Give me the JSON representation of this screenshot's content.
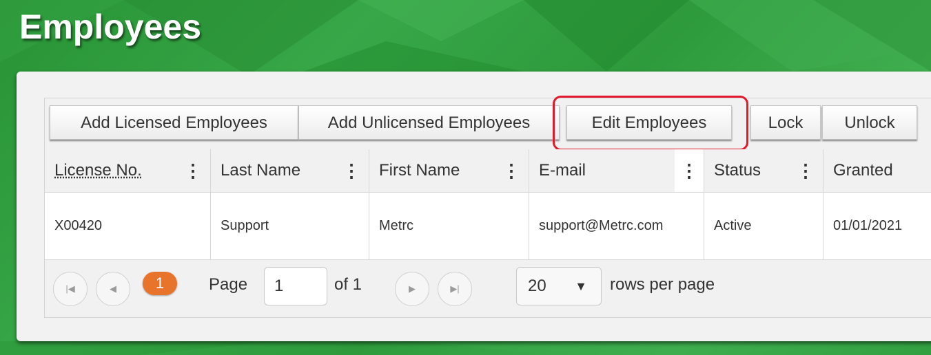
{
  "page": {
    "title": "Employees"
  },
  "toolbar": {
    "buttons": [
      {
        "label": "Add Licensed Employees"
      },
      {
        "label": "Add Unlicensed Employees"
      },
      {
        "label": "Edit Employees"
      },
      {
        "label": "Lock"
      },
      {
        "label": "Unlock"
      }
    ],
    "highlight_color": "#e2182c"
  },
  "table": {
    "columns": [
      {
        "label": "License No.",
        "menu_icon": "kebab-icon"
      },
      {
        "label": "Last Name",
        "menu_icon": "kebab-icon"
      },
      {
        "label": "First Name",
        "menu_icon": "kebab-icon"
      },
      {
        "label": "E-mail",
        "menu_icon": "kebab-icon"
      },
      {
        "label": "Status",
        "menu_icon": "kebab-icon"
      },
      {
        "label": "Granted"
      }
    ],
    "rows": [
      {
        "license_no": "X00420",
        "last_name": "Support",
        "first_name": "Metrc",
        "email": "support@Metrc.com",
        "status": "Active",
        "granted": "01/01/2021"
      }
    ]
  },
  "pager": {
    "current_page": "1",
    "page_label": "Page",
    "page_input": "1",
    "of_label": "of 1",
    "rows_per_page_value": "20",
    "rows_per_page_label": "rows per page",
    "accent_color": "#e8732a"
  },
  "colors": {
    "background": "#2f9a3e"
  }
}
